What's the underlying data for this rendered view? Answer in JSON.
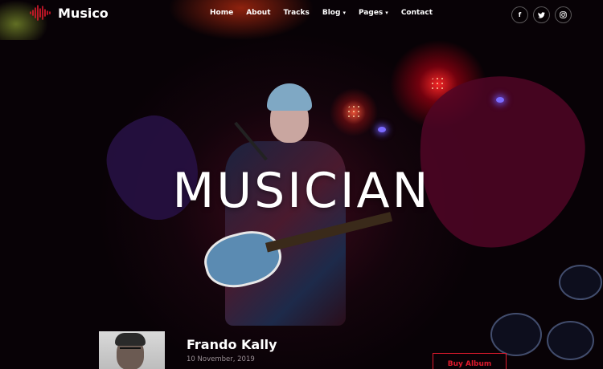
{
  "brand": {
    "name": "Musico",
    "logo_icon": "waveform-icon",
    "accent": "#e01a2d"
  },
  "nav": {
    "items": [
      {
        "label": "Home",
        "dropdown": false
      },
      {
        "label": "About",
        "dropdown": false
      },
      {
        "label": "Tracks",
        "dropdown": false
      },
      {
        "label": "Blog",
        "dropdown": true
      },
      {
        "label": "Pages",
        "dropdown": true
      },
      {
        "label": "Contact",
        "dropdown": false
      }
    ],
    "social": [
      {
        "name": "facebook-icon",
        "glyph": "f"
      },
      {
        "name": "twitter-icon",
        "glyph": "t"
      },
      {
        "name": "instagram-icon",
        "glyph": "◎"
      }
    ]
  },
  "hero": {
    "title": "MUSICIAN"
  },
  "album": {
    "artist": "Frando Kally",
    "date": "10 November, 2019",
    "button_label": "Buy Album"
  }
}
